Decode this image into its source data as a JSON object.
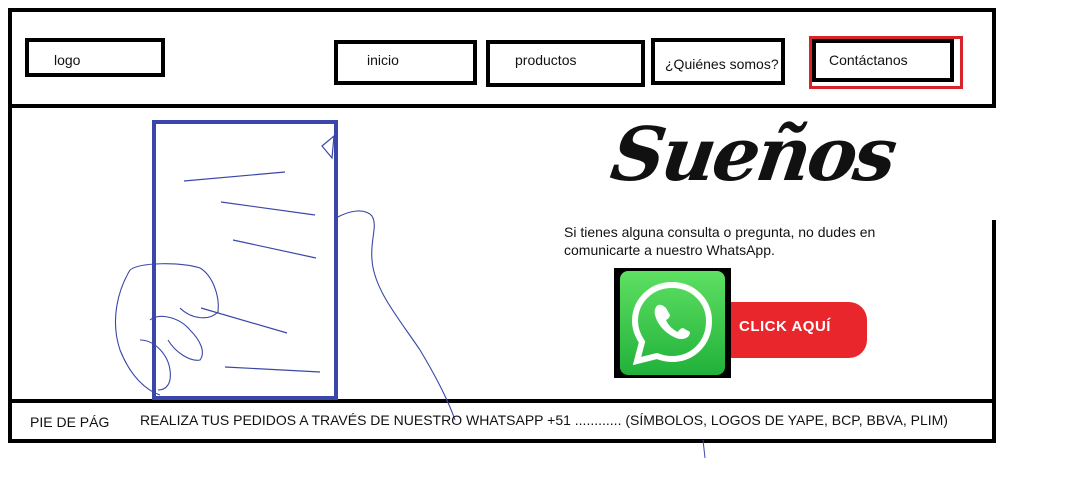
{
  "header": {
    "logo": "logo",
    "nav": {
      "inicio": "inicio",
      "productos": "productos",
      "quienes": "¿Quiénes somos?",
      "contacto": "Contáctanos"
    },
    "highlight_color": "#d6242a"
  },
  "main": {
    "brand_word": "Sueños",
    "promo_text": "Si tienes alguna consulta o pregunta, no dudes en comunicarte a nuestro WhatsApp.",
    "whatsapp_button": {
      "label": "CLICK AQUÍ",
      "icon": "whatsapp-icon",
      "green": "#25c03e",
      "red": "#e8262c"
    },
    "phone_sketch_color": "#3a47a8"
  },
  "footer": {
    "label": "PIE DE PÁG",
    "text": "REALIZA TUS PEDIDOS A TRAVÉS DE NUESTRO WHATSAPP +51 ............ (SÍMBOLOS, LOGOS DE YAPE, BCP, BBVA, PLIM)"
  }
}
